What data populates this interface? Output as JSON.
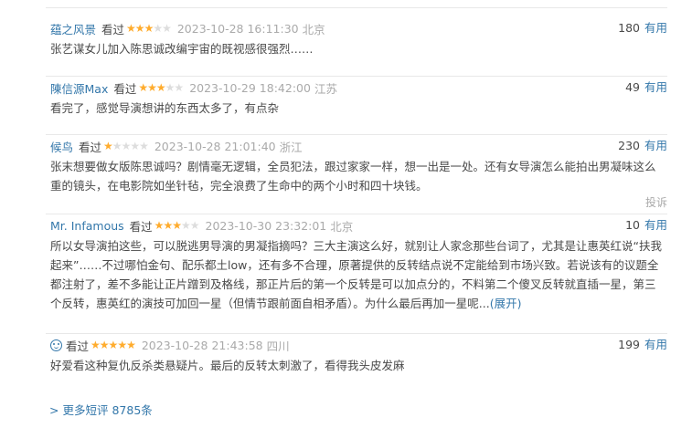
{
  "useful_label": "有用",
  "report_label": "投诉",
  "more": {
    "chevron": ">",
    "label": "更多短评 8785条"
  },
  "comments": [
    {
      "user": "蕴之风景",
      "rating_label": "看过",
      "stars": 3,
      "time": "2023-10-28 16:11:30",
      "location": "北京",
      "votes": "180",
      "text": "张艺谋女儿加入陈思诚改编宇宙的既视感很强烈……"
    },
    {
      "user": "陳信源Max",
      "rating_label": "看过",
      "stars": 3,
      "time": "2023-10-29 18:42:00",
      "location": "江苏",
      "votes": "49",
      "text": "看完了，感觉导演想讲的东西太多了，有点杂"
    },
    {
      "user": "候鸟",
      "rating_label": "看过",
      "stars": 1,
      "time": "2023-10-28 21:01:40",
      "location": "浙江",
      "votes": "230",
      "text": "张末想要做女版陈思诚吗？剧情毫无逻辑，全员犯法，跟过家家一样，想一出是一处。还有女导演怎么能拍出男凝味这么重的镜头，在电影院如坐针毡，完全浪费了生命中的两个小时和四十块钱。"
    },
    {
      "user": "Mr. Infamous",
      "rating_label": "看过",
      "stars": 3,
      "time": "2023-10-30 23:32:01",
      "location": "北京",
      "votes": "10",
      "text": "所以女导演拍这些，可以脱逃男导演的男凝指摘吗？三大主演这么好，就别让人家念那些台词了，尤其是让惠英红说“扶我起来”……不过哪怕金句、配乐都土low，还有多不合理，原著提供的反转结点说不定能给到市场兴致。若说该有的议题全都注射了，差不多能让正片蹭到及格线，那正片后的第一个反转是可以加点分的，不料第二个傻叉反转就直插一星，第三个反转，惠英红的演技可加回一星（但情节跟前面自相矛盾）。为什么最后再加一星呢...",
      "expand": "(展开)"
    },
    {
      "user": "",
      "rating_label": "看过",
      "stars": 5,
      "time": "2023-10-28 21:43:58",
      "location": "四川",
      "votes": "199",
      "text": "好爱看这种复仇反杀类悬疑片。最后的反转太刺激了，看得我头皮发麻"
    }
  ]
}
